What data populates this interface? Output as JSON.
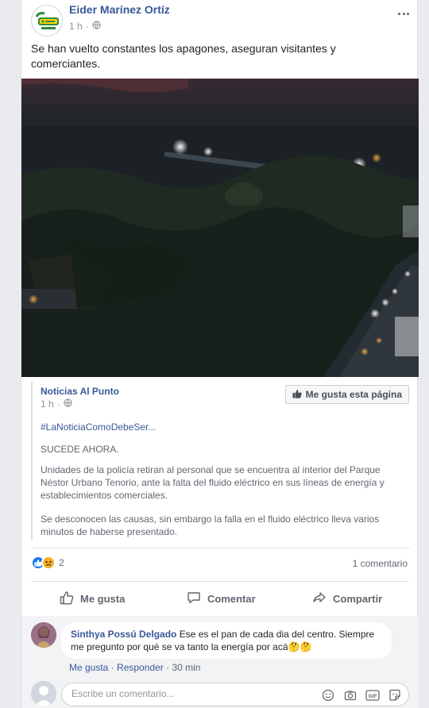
{
  "post": {
    "author": "Eider Marínez Ortíz",
    "time": "1 h",
    "text": "Se han vuelto constantes los apagones, aseguran visitantes y comerciantes."
  },
  "shared": {
    "page_name": "Noticias Al Punto",
    "time": "1 h",
    "like_page_label": "Me gusta esta página",
    "hashtag": "#LaNoticiaComoDebeSer...",
    "p1": "SUCEDE AHORA.",
    "p2": "Unidades de la policía retiran al personal que se encuentra al interior del Parque Néstor Urbano Tenorio, ante la falta del fluido eléctrico en sus líneas de energía y establecimientos comerciales.",
    "p3": "Se desconocen las causas, sin embargo la falla en el fluido eléctrico lleva varios minutos de haberse presentado."
  },
  "reactions": {
    "count": "2",
    "types": [
      "like-icon",
      "sad-icon"
    ]
  },
  "comment_count": "1 comentario",
  "actions": {
    "like": "Me gusta",
    "comment": "Comentar",
    "share": "Compartir"
  },
  "comment": {
    "author": "Sinthya Possú Delgado",
    "text": "Ese es el pan de cada dia del centro. Siempre me pregunto por qué se va tanto la energía por acá🤔🤔",
    "like": "Me gusta",
    "reply": "Responder",
    "time": "30 min"
  },
  "composer": {
    "placeholder": "Escribe un comentario..."
  },
  "colors": {
    "link": "#385898",
    "meta": "#90949c",
    "like": "#1877f2",
    "sad": "#f7b125"
  }
}
